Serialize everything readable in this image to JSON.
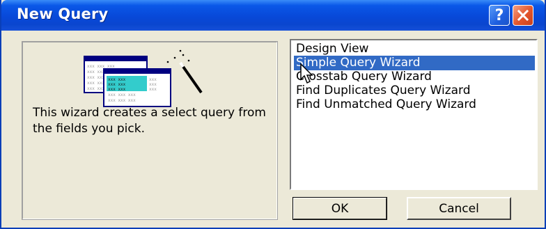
{
  "window": {
    "title": "New Query",
    "help_label": "?"
  },
  "left_panel": {
    "description": "This wizard creates a select query from the fields you pick.",
    "illustration_icon": "query-wizard-icon"
  },
  "list": {
    "items": [
      "Design View",
      "Simple Query Wizard",
      "Crosstab Query Wizard",
      "Find Duplicates Query Wizard",
      "Find Unmatched Query Wizard"
    ],
    "selected_index": 1
  },
  "buttons": {
    "ok": "OK",
    "cancel": "Cancel"
  },
  "colors": {
    "titlebar": "#0a58e8",
    "selection": "#316ac5",
    "dialog_bg": "#ece9d8",
    "close_button": "#e3552c"
  }
}
